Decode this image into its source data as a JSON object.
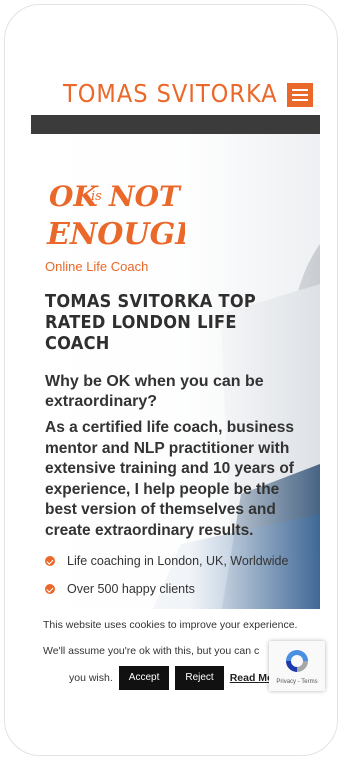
{
  "header": {
    "brand": "TOMAS SVITORKA",
    "menu_icon": "hamburger-menu-icon"
  },
  "hero": {
    "logo_text": "OK is NOT ENOUGH",
    "subtitle": "Online Life Coach",
    "title": "TOMAS SVITORKA TOP RATED LONDON LIFE COACH",
    "question": "Why be OK when you can be extraordinary?",
    "paragraph": "As a certified life coach, business mentor and NLP practitioner with extensive training and 10 years of experience, I help people be the best version of themselves and create extraordinary results.",
    "bullets": [
      "Life coaching in London, UK, Worldwide",
      "Over 500 happy clients"
    ]
  },
  "cookie": {
    "line1": "This website uses cookies to improve your experience.",
    "line2": "We'll assume you're ok with this, but you can c",
    "line3_prefix": "you wish.",
    "accept_label": "Accept",
    "reject_label": "Reject",
    "readmore_label": "Read Mo"
  },
  "recaptcha": {
    "footer": "Privacy - Terms"
  },
  "colors": {
    "accent": "#e9682a",
    "dark": "#3b3b3b"
  }
}
